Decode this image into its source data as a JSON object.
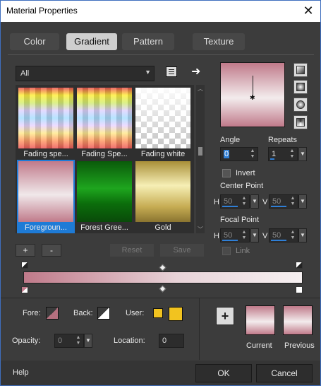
{
  "window": {
    "title": "Material Properties",
    "close_glyph": "✕"
  },
  "tabs": [
    {
      "label": "Color",
      "active": false
    },
    {
      "label": "Gradient",
      "active": true
    },
    {
      "label": "Pattern",
      "active": false
    },
    {
      "label": "Texture",
      "active": false
    }
  ],
  "category": {
    "value": "All"
  },
  "gallery": [
    {
      "caption": "Fading spe...",
      "style": "rainbow"
    },
    {
      "caption": "Fading Spe...",
      "style": "rainbow"
    },
    {
      "caption": "Fading white",
      "style": "checker"
    },
    {
      "caption": "Foregroun...",
      "style": "pink",
      "selected": true
    },
    {
      "caption": "Forest Gree...",
      "style": "green"
    },
    {
      "caption": "Gold",
      "style": "gold"
    }
  ],
  "gallery_buttons": {
    "add": "+",
    "remove": "-",
    "reset": "Reset",
    "save": "Save"
  },
  "angle": {
    "label": "Angle",
    "value": "0"
  },
  "repeats": {
    "label": "Repeats",
    "value": "1"
  },
  "invert": {
    "label": "Invert"
  },
  "center_point": {
    "label": "Center Point",
    "h_label": "H",
    "h_value": "50",
    "v_label": "V",
    "v_value": "50"
  },
  "focal_point": {
    "label": "Focal Point",
    "h_label": "H",
    "h_value": "50",
    "v_label": "V",
    "v_value": "50"
  },
  "link": {
    "label": "Link"
  },
  "colors_row": {
    "fore_label": "Fore:",
    "back_label": "Back:",
    "user_label": "User:",
    "fore_color": "#b5707f",
    "user_color": "#f2c31f"
  },
  "opacity": {
    "label": "Opacity:",
    "value": "0"
  },
  "location": {
    "label": "Location:",
    "value": "0"
  },
  "result": {
    "add": "+",
    "current_label": "Current",
    "previous_label": "Previous"
  },
  "footer": {
    "help": "Help",
    "ok": "OK",
    "cancel": "Cancel"
  },
  "colors": {
    "pink": "#c07a8a",
    "accent": "#1e7bd6",
    "bg": "#3c3c3c"
  },
  "icons": [
    "close-icon",
    "chevron-down-icon",
    "save-list-icon",
    "arrow-right-icon",
    "plus-icon",
    "color-stop-icon",
    "gradient-style-icon"
  ]
}
